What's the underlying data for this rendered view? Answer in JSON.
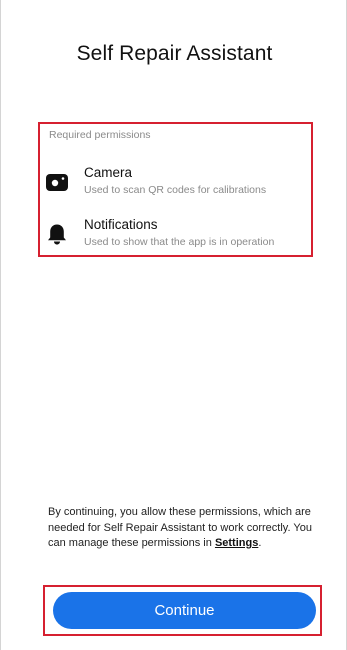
{
  "app": {
    "title": "Self Repair Assistant"
  },
  "permissions": {
    "heading": "Required permissions",
    "items": [
      {
        "icon": "camera-icon",
        "name": "Camera",
        "description": "Used to scan QR codes for calibrations"
      },
      {
        "icon": "bell-icon",
        "name": "Notifications",
        "description": "Used to show that the app is in operation"
      }
    ]
  },
  "footer": {
    "text_before": "By continuing, you allow these permissions, which are needed for Self Repair Assistant to work correctly. You can manage these permissions in ",
    "settings_link": "Settings",
    "text_after": "."
  },
  "continue_button": {
    "label": "Continue"
  },
  "colors": {
    "accent": "#1a73e8",
    "highlight_border": "#d62030"
  }
}
